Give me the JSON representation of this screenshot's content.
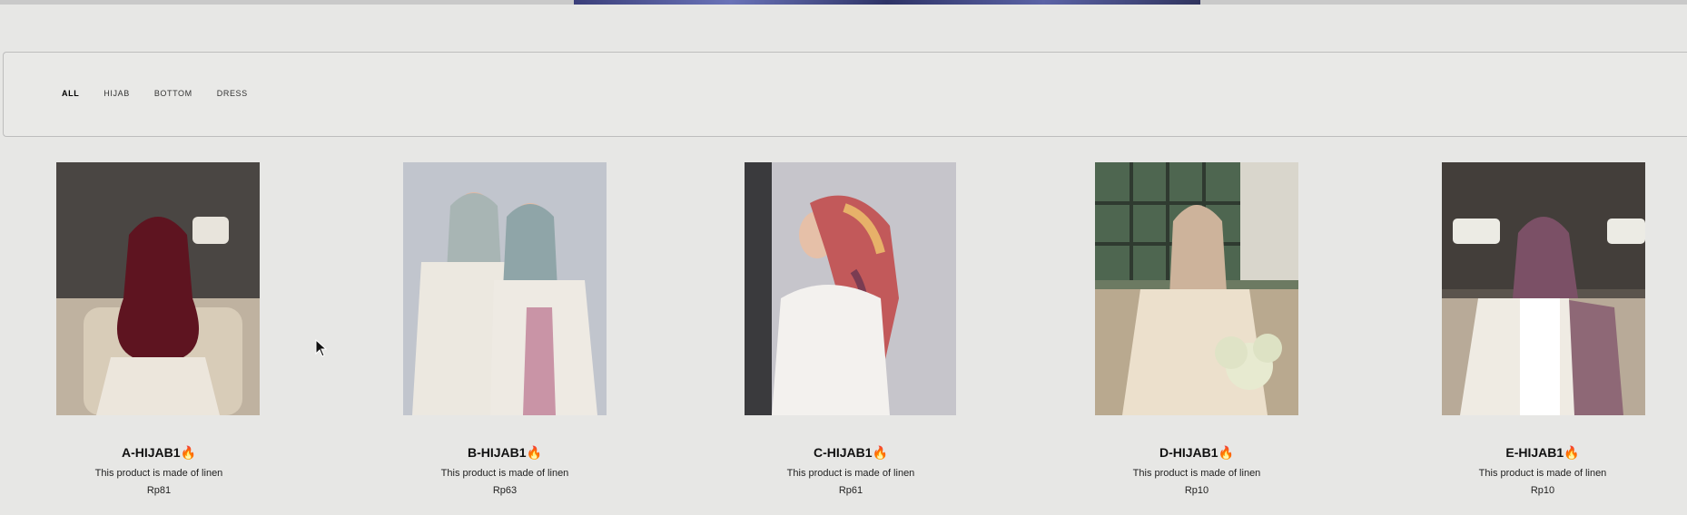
{
  "filters": {
    "tabs": [
      {
        "label": "ALL",
        "active": true
      },
      {
        "label": "HIJAB",
        "active": false
      },
      {
        "label": "BOTTOM",
        "active": false
      },
      {
        "label": "DRESS",
        "active": false
      }
    ]
  },
  "products": [
    {
      "name": "A-HIJAB1🔥",
      "description": "This product is made of linen",
      "price": "Rp81",
      "scarf_color": "#5e1420"
    },
    {
      "name": "B-HIJAB1🔥",
      "description": "This product is made of linen",
      "price": "Rp63",
      "scarf_color": "#8fa5a8"
    },
    {
      "name": "C-HIJAB1🔥",
      "description": "This product is made of linen",
      "price": "Rp61",
      "scarf_color": "#c2595a"
    },
    {
      "name": "D-HIJAB1🔥",
      "description": "This product is made of linen",
      "price": "Rp10",
      "scarf_color": "#cdb39b"
    },
    {
      "name": "E-HIJAB1🔥",
      "description": "This product is made of linen",
      "price": "Rp10",
      "scarf_color": "#7b5066"
    }
  ]
}
